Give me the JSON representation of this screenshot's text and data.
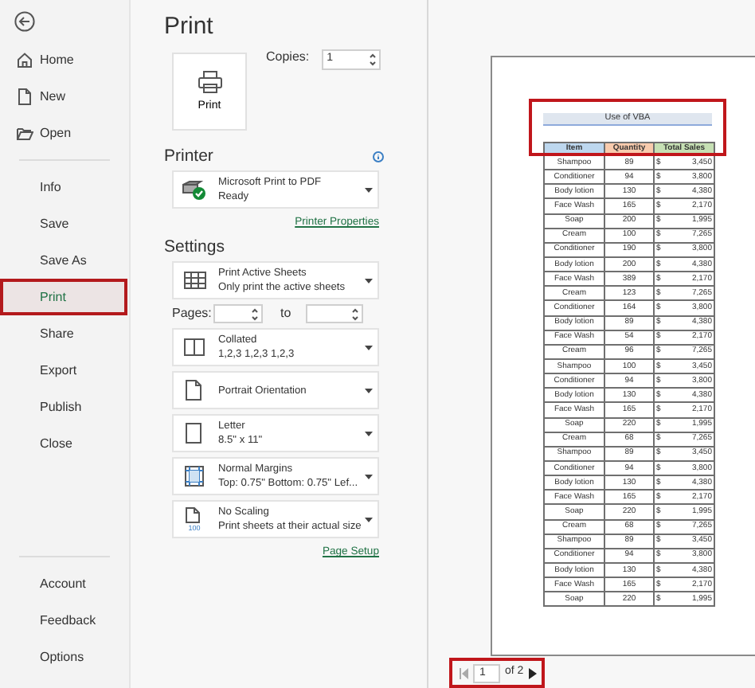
{
  "sidebar": {
    "groups": [
      {
        "items": [
          {
            "label": "Home",
            "selected": false,
            "highlighted": false
          },
          {
            "label": "New",
            "selected": false,
            "highlighted": false
          },
          {
            "label": "Open",
            "selected": false,
            "highlighted": false
          }
        ]
      },
      {
        "items": [
          {
            "label": "Info",
            "selected": false,
            "highlighted": false
          },
          {
            "label": "Save",
            "selected": false,
            "highlighted": false
          },
          {
            "label": "Save As",
            "selected": false,
            "highlighted": false
          },
          {
            "label": "Print",
            "selected": true,
            "highlighted": true
          },
          {
            "label": "Share",
            "selected": false,
            "highlighted": false
          },
          {
            "label": "Export",
            "selected": false,
            "highlighted": false
          },
          {
            "label": "Publish",
            "selected": false,
            "highlighted": false
          },
          {
            "label": "Close",
            "selected": false,
            "highlighted": false
          }
        ]
      },
      {
        "items": [
          {
            "label": "Account",
            "selected": false,
            "highlighted": false
          },
          {
            "label": "Feedback",
            "selected": false,
            "highlighted": false
          },
          {
            "label": "Options",
            "selected": false,
            "highlighted": false
          }
        ]
      }
    ]
  },
  "print_panel": {
    "title": "Print",
    "print_button": "Print",
    "copies": {
      "label": "Copies:",
      "value": "1"
    },
    "printer": {
      "heading": "Printer",
      "name": "Microsoft Print to PDF",
      "status": "Ready",
      "link": "Printer Properties"
    },
    "settings": {
      "heading": "Settings",
      "options": [
        {
          "kind": "sheets",
          "title": "Print Active Sheets",
          "subtitle": "Only print the active sheets"
        },
        {
          "kind": "pages",
          "label": "Pages:",
          "to": "to"
        },
        {
          "kind": "collated",
          "title": "Collated",
          "subtitle": "1,2,3    1,2,3    1,2,3"
        },
        {
          "kind": "orientation",
          "title": "Portrait Orientation"
        },
        {
          "kind": "paper",
          "title": "Letter",
          "subtitle": "8.5\" x 11\""
        },
        {
          "kind": "margins",
          "title": "Normal Margins",
          "subtitle": "Top: 0.75\" Bottom: 0.75\" Lef..."
        },
        {
          "kind": "scaling",
          "title": "No Scaling",
          "subtitle": "Print sheets at their actual size",
          "icon_text": "100"
        }
      ],
      "link": "Page Setup"
    }
  },
  "preview": {
    "title": "Use of VBA",
    "title_highlighted": true,
    "columns": [
      {
        "label": "Item",
        "color": "#bdd7ee"
      },
      {
        "label": "Quantity",
        "color": "#f8cbad"
      },
      {
        "label": "Total Sales",
        "color": "#c6e0b4"
      }
    ],
    "rows": [
      {
        "item": "Shampoo",
        "quantity": "89",
        "currency": "$",
        "total": "3,450"
      },
      {
        "item": "Conditioner",
        "quantity": "94",
        "currency": "$",
        "total": "3,800"
      },
      {
        "item": "Body lotion",
        "quantity": "130",
        "currency": "$",
        "total": "4,380"
      },
      {
        "item": "Face Wash",
        "quantity": "165",
        "currency": "$",
        "total": "2,170"
      },
      {
        "item": "Soap",
        "quantity": "200",
        "currency": "$",
        "total": "1,995"
      },
      {
        "item": "Cream",
        "quantity": "100",
        "currency": "$",
        "total": "7,265"
      },
      {
        "item": "Conditioner",
        "quantity": "190",
        "currency": "$",
        "total": "3,800"
      },
      {
        "item": "Body lotion",
        "quantity": "200",
        "currency": "$",
        "total": "4,380"
      },
      {
        "item": "Face Wash",
        "quantity": "389",
        "currency": "$",
        "total": "2,170"
      },
      {
        "item": "Cream",
        "quantity": "123",
        "currency": "$",
        "total": "7,265"
      },
      {
        "item": "Conditioner",
        "quantity": "164",
        "currency": "$",
        "total": "3,800"
      },
      {
        "item": "Body lotion",
        "quantity": "89",
        "currency": "$",
        "total": "4,380"
      },
      {
        "item": "Face Wash",
        "quantity": "54",
        "currency": "$",
        "total": "2,170"
      },
      {
        "item": "Cream",
        "quantity": "96",
        "currency": "$",
        "total": "7,265"
      },
      {
        "item": "Shampoo",
        "quantity": "100",
        "currency": "$",
        "total": "3,450"
      },
      {
        "item": "Conditioner",
        "quantity": "94",
        "currency": "$",
        "total": "3,800"
      },
      {
        "item": "Body lotion",
        "quantity": "130",
        "currency": "$",
        "total": "4,380"
      },
      {
        "item": "Face Wash",
        "quantity": "165",
        "currency": "$",
        "total": "2,170"
      },
      {
        "item": "Soap",
        "quantity": "220",
        "currency": "$",
        "total": "1,995"
      },
      {
        "item": "Cream",
        "quantity": "68",
        "currency": "$",
        "total": "7,265"
      },
      {
        "item": "Shampoo",
        "quantity": "89",
        "currency": "$",
        "total": "3,450"
      },
      {
        "item": "Conditioner",
        "quantity": "94",
        "currency": "$",
        "total": "3,800"
      },
      {
        "item": "Body lotion",
        "quantity": "130",
        "currency": "$",
        "total": "4,380"
      },
      {
        "item": "Face Wash",
        "quantity": "165",
        "currency": "$",
        "total": "2,170"
      },
      {
        "item": "Soap",
        "quantity": "220",
        "currency": "$",
        "total": "1,995"
      },
      {
        "item": "Cream",
        "quantity": "68",
        "currency": "$",
        "total": "7,265"
      },
      {
        "item": "Shampoo",
        "quantity": "89",
        "currency": "$",
        "total": "3,450"
      },
      {
        "item": "Conditioner",
        "quantity": "94",
        "currency": "$",
        "total": "3,800"
      },
      {
        "item": "Body lotion",
        "quantity": "130",
        "currency": "$",
        "total": "4,380"
      },
      {
        "item": "Face Wash",
        "quantity": "165",
        "currency": "$",
        "total": "2,170"
      },
      {
        "item": "Soap",
        "quantity": "220",
        "currency": "$",
        "total": "1,995"
      }
    ],
    "pager": {
      "page": "1",
      "total": "of 2",
      "highlighted": true
    }
  }
}
